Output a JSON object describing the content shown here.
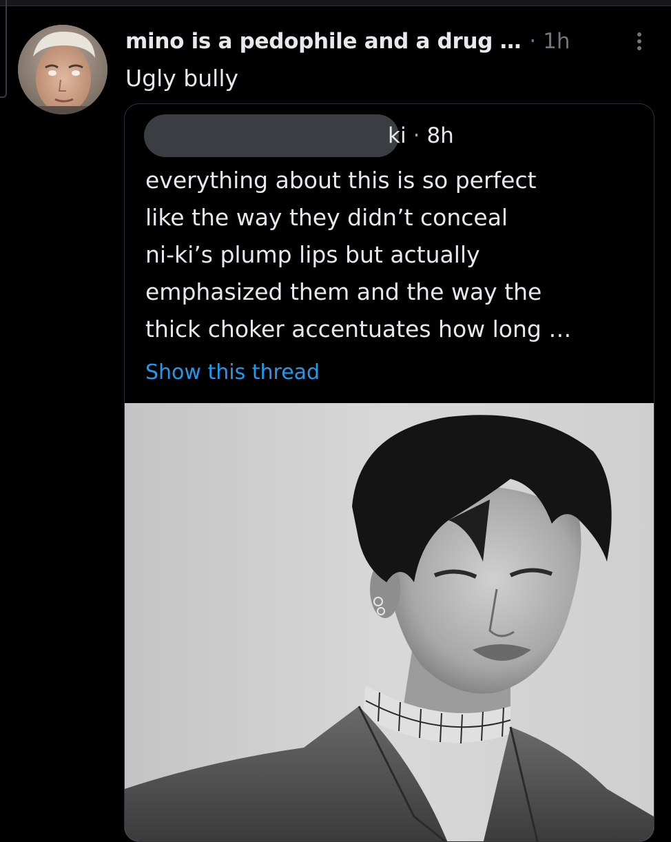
{
  "tweet": {
    "author_name": "mino is a pedophile and a drug …",
    "separator": "·",
    "timestamp": "1h",
    "text": "Ugly bully",
    "avatar_icon": "user-avatar-photo",
    "more_icon": "more-vertical-icon"
  },
  "quoted_tweet": {
    "handle_visible_suffix": "ki",
    "separator": "·",
    "timestamp": "8h",
    "text_lines": [
      "everything about this is so perfect",
      "like the way they didn’t conceal",
      "ni-ki’s plump lips but actually",
      "emphasized them and the way the",
      "thick choker accentuates how long …"
    ],
    "show_thread_label": "Show this thread",
    "photo_icon": "portrait-photo"
  },
  "colors": {
    "background": "#000000",
    "text_primary": "#e7e9ea",
    "text_secondary": "#71767b",
    "link": "#1d9bf0",
    "border": "#2f3336"
  }
}
